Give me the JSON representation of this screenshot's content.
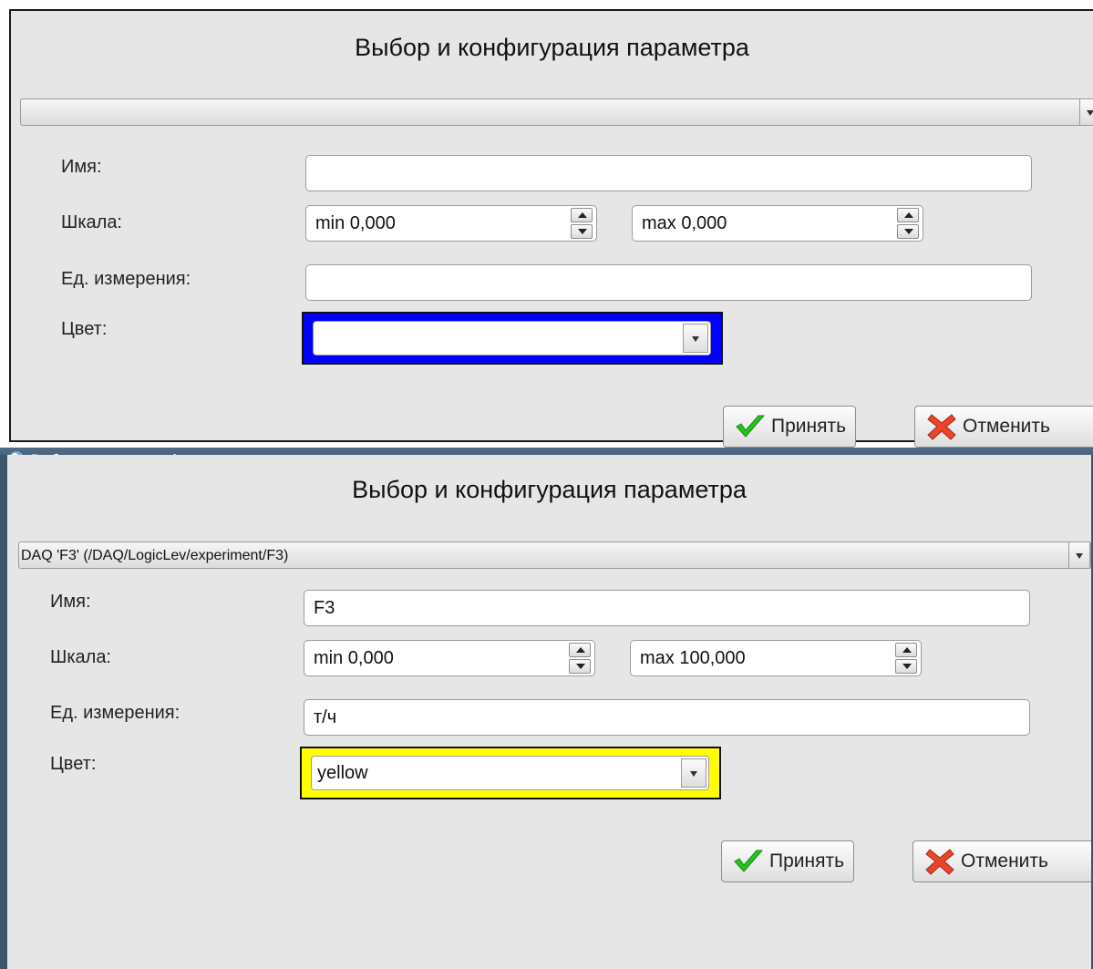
{
  "dialogs": [
    {
      "heading": "Выбор и конфигурация параметра",
      "parameter_select": {
        "value": ""
      },
      "fields": {
        "name_label": "Имя:",
        "name_value": "",
        "scale_label": "Шкала:",
        "scale_min": "min 0,000",
        "scale_max": "max 0,000",
        "units_label": "Ед. измерения:",
        "units_value": "",
        "color_label": "Цвет:",
        "color_value": "",
        "color_swatch": "#0000ff"
      },
      "buttons": {
        "accept": "Принять",
        "cancel": "Отменить"
      }
    },
    {
      "window_title": "Выбор параметра графика",
      "heading": "Выбор и конфигурация параметра",
      "parameter_select": {
        "value": "DAQ 'F3' (/DAQ/LogicLev/experiment/F3)"
      },
      "fields": {
        "name_label": "Имя:",
        "name_value": "F3",
        "scale_label": "Шкала:",
        "scale_min": "min 0,000",
        "scale_max": "max 100,000",
        "units_label": "Ед. измерения:",
        "units_value": "т/ч",
        "color_label": "Цвет:",
        "color_value": "yellow",
        "color_swatch": "#ffff00"
      },
      "buttons": {
        "accept": "Принять",
        "cancel": "Отменить"
      }
    }
  ],
  "icons": {
    "accept": "check-icon",
    "cancel": "cross-icon",
    "window": "app-icon",
    "maximize": "maximize-icon",
    "close": "close-icon"
  },
  "colors": {
    "window_titlebar": "#3b566c",
    "dialog_background": "#e6e6e6"
  }
}
